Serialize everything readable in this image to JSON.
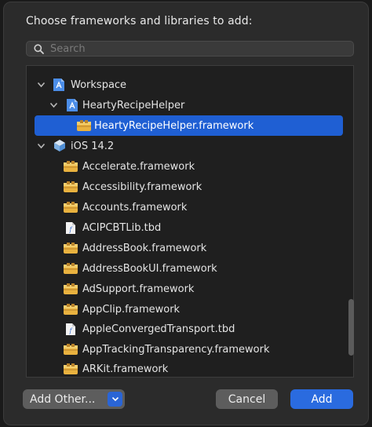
{
  "dialog": {
    "title": "Choose frameworks and libraries to add:",
    "search_placeholder": "Search"
  },
  "tree": [
    {
      "label": "Workspace",
      "icon": "workspace-icon",
      "expanded": true
    },
    {
      "label": "HeartyRecipeHelper",
      "icon": "project-icon",
      "expanded": true
    },
    {
      "label": "HeartyRecipeHelper.framework",
      "icon": "framework-icon",
      "selected": true
    },
    {
      "label": "iOS 14.2",
      "icon": "sdk-icon",
      "expanded": true
    },
    {
      "label": "Accelerate.framework",
      "icon": "framework-icon"
    },
    {
      "label": "Accessibility.framework",
      "icon": "framework-icon"
    },
    {
      "label": "Accounts.framework",
      "icon": "framework-icon"
    },
    {
      "label": "ACIPCBTLib.tbd",
      "icon": "tbd-file-icon"
    },
    {
      "label": "AddressBook.framework",
      "icon": "framework-icon"
    },
    {
      "label": "AddressBookUI.framework",
      "icon": "framework-icon"
    },
    {
      "label": "AdSupport.framework",
      "icon": "framework-icon"
    },
    {
      "label": "AppClip.framework",
      "icon": "framework-icon"
    },
    {
      "label": "AppleConvergedTransport.tbd",
      "icon": "tbd-file-icon"
    },
    {
      "label": "AppTrackingTransparency.framework",
      "icon": "framework-icon"
    },
    {
      "label": "ARKit.framework",
      "icon": "framework-icon"
    }
  ],
  "buttons": {
    "add_other": "Add Other...",
    "cancel": "Cancel",
    "add": "Add"
  },
  "colors": {
    "selection": "#1f5fd3",
    "accent": "#2a6bdf",
    "framework_icon": "#e9b23f"
  }
}
